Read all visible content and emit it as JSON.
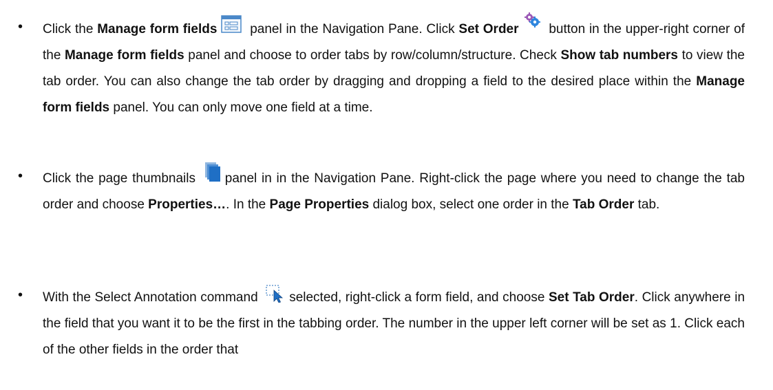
{
  "bullets": {
    "char": "•"
  },
  "item1": {
    "t1": "Click the ",
    "b1": "Manage form fields",
    "icon1": "form-fields-panel-icon",
    "t2": " panel in the Navigation Pane. Click ",
    "b2": "Set Order",
    "icon2": "gears-icon",
    "t3": " button in the upper-right corner of the ",
    "b3": "Manage form fields",
    "t4": " panel and choose to order tabs by row/column/structure. Check ",
    "b4": "Show tab numbers",
    "t5": " to view the tab order. You can also change the tab order by dragging and dropping a field to the desired place within the ",
    "b5": "Manage form fields",
    "t6": " panel. You can only move one field at a time."
  },
  "item2": {
    "t1": "Click the page thumbnails ",
    "icon1": "page-thumbnails-icon",
    "t2": "panel in in the Navigation Pane. Right-click the page where you need to change the tab order and choose ",
    "b1": "Properties…",
    "t3": ". In the ",
    "b2": "Page Properties",
    "t4": " dialog box, select one order in the ",
    "b3": "Tab Order",
    "t5": " tab."
  },
  "item3": {
    "t1": "With the Select Annotation command ",
    "icon1": "select-annotation-icon",
    "t2": "selected, right-click a form field, and choose ",
    "b1": "Set Tab Order",
    "t3": ". Click anywhere in the field that you want it to be the first in the tabbing order. The number in the upper left corner will be set as 1. Click each of the other fields in the order that"
  }
}
